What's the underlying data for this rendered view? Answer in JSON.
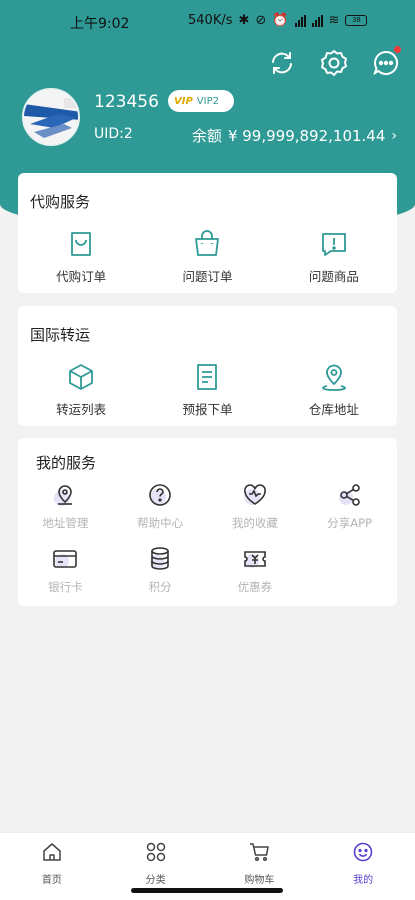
{
  "status": {
    "time": "上午9:02",
    "speed": "540K/s",
    "battery": "38"
  },
  "profile": {
    "username": "123456",
    "vip_badge": "VIP",
    "vip_level": "VIP2",
    "uid": "UID:2",
    "balance_label": "余额",
    "balance_value": "¥ 99,999,892,101.44"
  },
  "sections": {
    "purchase": {
      "title": "代购服务",
      "items": [
        {
          "label": "代购订单",
          "icon": "shopping-bag-icon"
        },
        {
          "label": "问题订单",
          "icon": "bag-handle-icon"
        },
        {
          "label": "问题商品",
          "icon": "alert-message-icon"
        }
      ]
    },
    "shipping": {
      "title": "国际转运",
      "items": [
        {
          "label": "转运列表",
          "icon": "box-icon"
        },
        {
          "label": "预报下单",
          "icon": "document-icon"
        },
        {
          "label": "仓库地址",
          "icon": "location-pin-icon"
        }
      ]
    },
    "my_services": {
      "title": "我的服务",
      "items": [
        {
          "label": "地址管理",
          "icon": "map-pin-icon"
        },
        {
          "label": "帮助中心",
          "icon": "help-icon"
        },
        {
          "label": "我的收藏",
          "icon": "heart-icon"
        },
        {
          "label": "分享APP",
          "icon": "share-icon"
        },
        {
          "label": "银行卡",
          "icon": "bank-card-icon"
        },
        {
          "label": "积分",
          "icon": "coins-icon"
        },
        {
          "label": "优惠券",
          "icon": "coupon-icon"
        }
      ]
    }
  },
  "tabbar": [
    {
      "label": "首页",
      "icon": "home-icon"
    },
    {
      "label": "分类",
      "icon": "category-icon"
    },
    {
      "label": "购物车",
      "icon": "cart-icon"
    },
    {
      "label": "我的",
      "icon": "user-face-icon",
      "active": true
    }
  ],
  "colors": {
    "primary": "#2f9a95",
    "active_tab": "#5a3fd0",
    "notification": "#f03a3a"
  }
}
